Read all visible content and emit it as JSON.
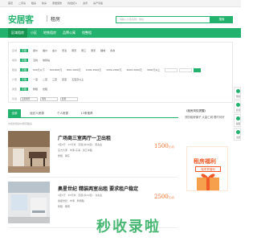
{
  "topbar": {
    "items": [
      "首页",
      "二手房",
      "租房",
      "新房",
      "家居装修",
      "找经纪人",
      "资讯",
      "房产问答"
    ]
  },
  "header": {
    "logo": "安居客",
    "sub": "租房",
    "search_placeholder": "请输入小区名称、地址",
    "search_button": "搜索"
  },
  "nav": {
    "items": [
      "区域租房",
      "小区",
      "地铁租房",
      "品牌公寓",
      "找整租"
    ]
  },
  "filters": {
    "rows": [
      {
        "label": "区域",
        "options": [
          "不限",
          "郑州",
          "福州",
          "金沙",
          "安溪",
          "南安",
          "晋江",
          "惠安",
          "鲤城",
          "永春"
        ],
        "active": 0
      },
      {
        "label": "地铁",
        "options": [
          "不限",
          "沿线",
          "地铁站"
        ],
        "active": 0
      },
      {
        "label": "租金",
        "options": [
          "不限",
          "500元以下",
          "500-800元",
          "800-1000元",
          "1000-1500元",
          "1500-2000元",
          "2000-3000元",
          "3000元以上"
        ],
        "active": 0
      },
      {
        "label": "户型",
        "options": [
          "不限",
          "一室",
          "二室",
          "三室",
          "四室",
          "五室及以上"
        ],
        "active": 0
      },
      {
        "label": "类型",
        "options": [
          "不限",
          "整租",
          "合租"
        ],
        "active": 0
      },
      {
        "label": "筛选",
        "options": [
          "房屋类型",
          "朝向",
          "装修"
        ],
        "active": -1
      }
    ]
  },
  "tabs": {
    "items": [
      "全部",
      "经纪人房源",
      "个人房源",
      "13条推荐"
    ],
    "active": 0,
    "note": "为您找到泉州所有租房"
  },
  "listings": [
    {
      "title": "广场商三室两厅一卫出租",
      "lines": [
        "3室2厅 · 97平米 · 高层(共32层) · 陈先生",
        "东方大厦 · 丰泽-东海 · 滨江中路",
        "整租 · 朝东"
      ],
      "price": "1500",
      "unit": "元/月"
    },
    {
      "title": "奥星世纪 精装两室出租 要求租户稳定",
      "lines": [
        "2室1厅 · 87平米 · 高层(共31层) · 许先生",
        "奥星世纪 · 丰泽 · 刺桐路",
        "整租 · 朝南"
      ],
      "price": "2500",
      "unit": "元/月"
    }
  ],
  "sidebar": {
    "title": "《租房风险提醒》",
    "desc": "谨防租房骗子 大量仁城 限时问好",
    "promo_title": "租房福利",
    "promo_sub": "保来宾福利"
  },
  "floatbar": {
    "items": [
      "帮助",
      "反馈",
      "客服",
      "顶部"
    ]
  },
  "watermark": {
    "text": "秒收录啦"
  },
  "colors": {
    "brand": "#23b26d",
    "price": "#f56b22",
    "promo": "#f05a28"
  }
}
